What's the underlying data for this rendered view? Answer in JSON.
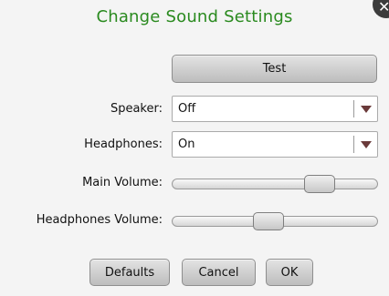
{
  "dialog": {
    "title": "Change Sound Settings",
    "close_glyph": "✕"
  },
  "test_button": {
    "label": "Test"
  },
  "speaker": {
    "label": "Speaker:",
    "value": "Off"
  },
  "headphones": {
    "label": "Headphones:",
    "value": "On"
  },
  "main_volume": {
    "label": "Main Volume:",
    "level": 0.72
  },
  "headphones_volume": {
    "label": "Headphones Volume:",
    "level": 0.47
  },
  "footer": {
    "defaults_label": "Defaults",
    "cancel_label": "Cancel",
    "ok_label": "OK"
  },
  "colors": {
    "title": "#2a8a1f",
    "arrow": "#6a3a3a"
  }
}
